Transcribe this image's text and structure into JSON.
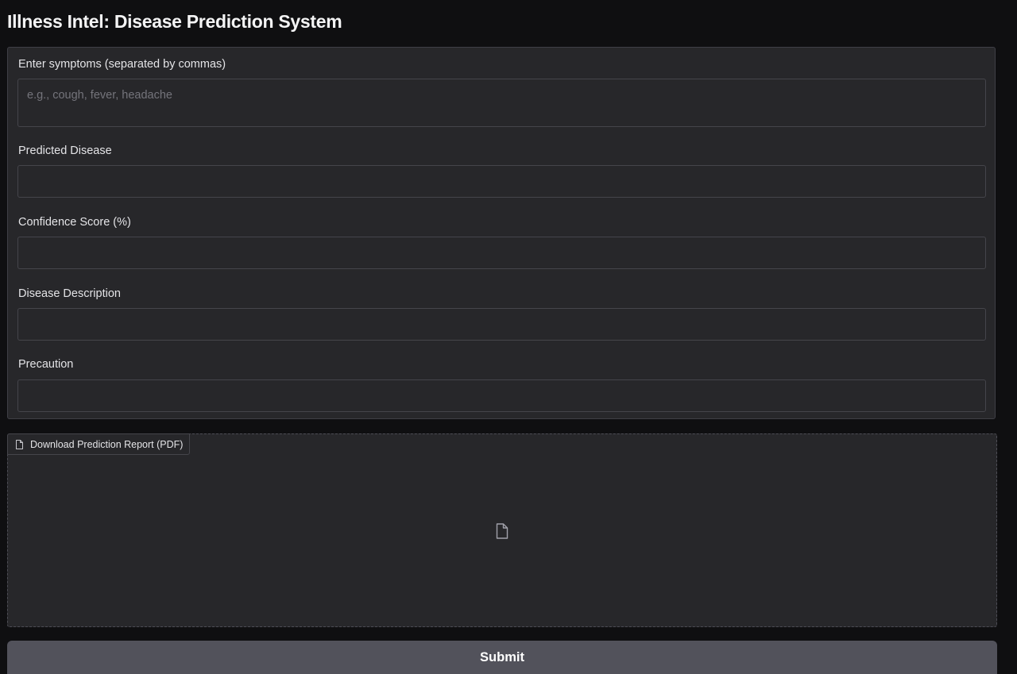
{
  "page": {
    "title": "Illness Intel: Disease Prediction System"
  },
  "form": {
    "symptoms": {
      "label": "Enter symptoms (separated by commas)",
      "value": "",
      "placeholder": "e.g., cough, fever, headache"
    },
    "predicted_disease": {
      "label": "Predicted Disease",
      "value": ""
    },
    "confidence_score": {
      "label": "Confidence Score (%)",
      "value": ""
    },
    "disease_description": {
      "label": "Disease Description",
      "value": ""
    },
    "precaution": {
      "label": "Precaution",
      "value": ""
    }
  },
  "download": {
    "label": "Download Prediction Report (PDF)",
    "icon": "file-icon"
  },
  "actions": {
    "submit_label": "Submit"
  },
  "colors": {
    "background": "#0f0f11",
    "panel": "#27272a",
    "border": "#45454b",
    "button": "#52525b"
  }
}
